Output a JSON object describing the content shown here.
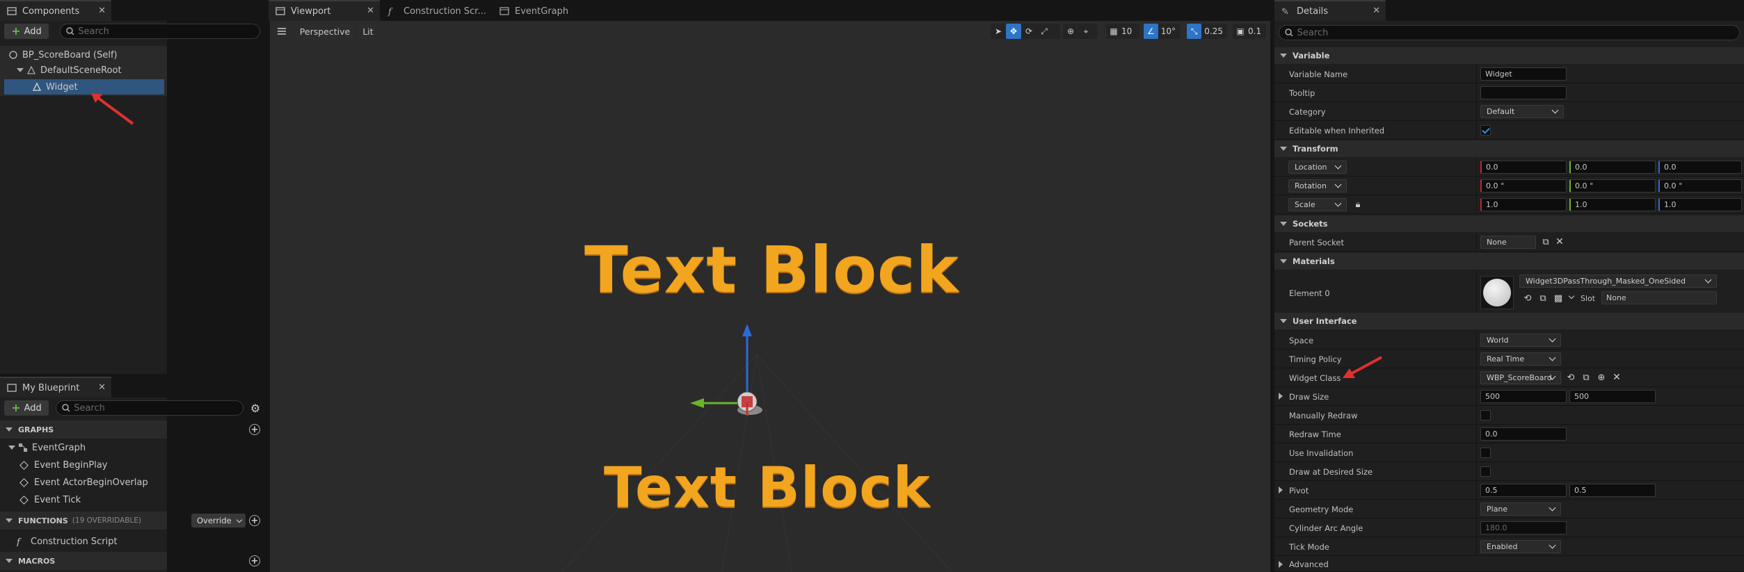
{
  "components": {
    "tab_label": "Components",
    "add_label": "Add",
    "search_placeholder": "Search",
    "tree": [
      {
        "label": "BP_ScoreBoard (Self)"
      },
      {
        "label": "DefaultSceneRoot"
      },
      {
        "label": "Widget"
      }
    ]
  },
  "my_blueprint": {
    "tab_label": "My Blueprint",
    "add_label": "Add",
    "search_placeholder": "Search",
    "graphs_label": "GRAPHS",
    "event_graph": "EventGraph",
    "events": [
      "Event BeginPlay",
      "Event ActorBeginOverlap",
      "Event Tick"
    ],
    "functions_label": "FUNCTIONS",
    "functions_count": "(19 OVERRIDABLE)",
    "override_label": "Override",
    "construction_script": "Construction Script",
    "macros_label": "MACROS"
  },
  "center_tabs": [
    "Viewport",
    "Construction Scr...",
    "EventGraph"
  ],
  "viewport": {
    "perspective": "Perspective",
    "lit": "Lit",
    "grid_snap": "10",
    "rot_snap": "10°",
    "scale_snap": "0.25",
    "camera_speed": "0.1",
    "text_block_1": "Text Block",
    "text_block_2": "Text Block"
  },
  "details": {
    "tab_label": "Details",
    "search_placeholder": "Search",
    "sections": {
      "variable": "Variable",
      "transform": "Transform",
      "sockets": "Sockets",
      "materials": "Materials",
      "user_interface": "User Interface",
      "advanced": "Advanced"
    },
    "variable_name_label": "Variable Name",
    "variable_name": "Widget",
    "tooltip_label": "Tooltip",
    "category_label": "Category",
    "category": "Default",
    "editable_label": "Editable when Inherited",
    "location_label": "Location",
    "location": [
      "0.0",
      "0.0",
      "0.0"
    ],
    "rotation_label": "Rotation",
    "rotation": [
      "0.0 °",
      "0.0 °",
      "0.0 °"
    ],
    "scale_label": "Scale",
    "scale": [
      "1.0",
      "1.0",
      "1.0"
    ],
    "parent_socket_label": "Parent Socket",
    "parent_socket": "None",
    "element0_label": "Element 0",
    "material": "Widget3DPassThrough_Masked_OneSided",
    "slot_label": "Slot",
    "slot": "None",
    "space_label": "Space",
    "space": "World",
    "timing_label": "Timing Policy",
    "timing": "Real Time",
    "widget_class_label": "Widget Class",
    "widget_class": "WBP_ScoreBoard",
    "draw_size_label": "Draw Size",
    "draw_size": [
      "500",
      "500"
    ],
    "manually_redraw_label": "Manually Redraw",
    "redraw_time_label": "Redraw Time",
    "redraw_time": "0.0",
    "use_invalidation_label": "Use Invalidation",
    "draw_desired_label": "Draw at Desired Size",
    "pivot_label": "Pivot",
    "pivot": [
      "0.5",
      "0.5"
    ],
    "geometry_label": "Geometry Mode",
    "geometry": "Plane",
    "cyl_label": "Cylinder Arc Angle",
    "cyl": "180.0",
    "tick_label": "Tick Mode",
    "tick": "Enabled"
  },
  "colors": {
    "accent": "#2e74c7",
    "text_block": "#f2a51e",
    "annotation_arrow": "#e03030"
  }
}
